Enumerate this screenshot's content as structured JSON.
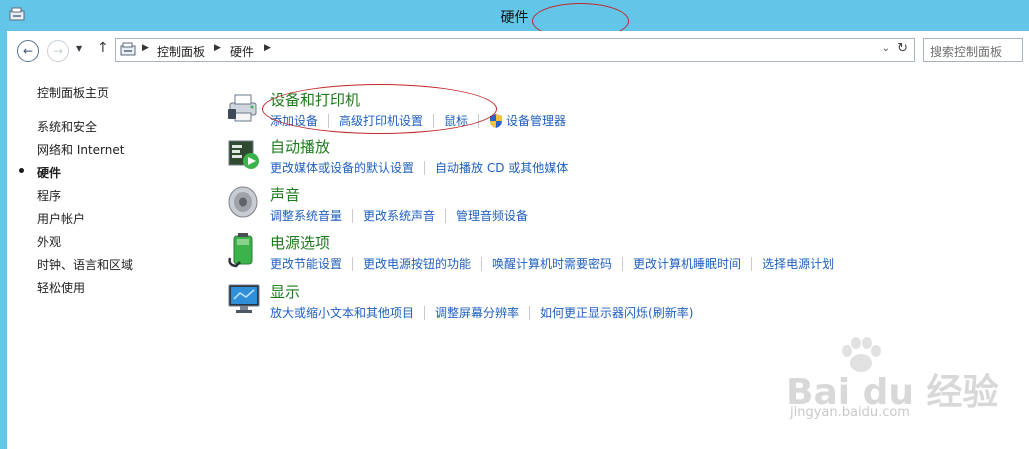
{
  "window": {
    "title": "硬件"
  },
  "address": {
    "crumbs": [
      "控制面板",
      "硬件"
    ],
    "search_placeholder": "搜索控制面板"
  },
  "sidebar": {
    "home": "控制面板主页",
    "items": [
      {
        "label": "系统和安全",
        "current": false
      },
      {
        "label": "网络和 Internet",
        "current": false
      },
      {
        "label": "硬件",
        "current": true
      },
      {
        "label": "程序",
        "current": false
      },
      {
        "label": "用户帐户",
        "current": false
      },
      {
        "label": "外观",
        "current": false
      },
      {
        "label": "时钟、语言和区域",
        "current": false
      },
      {
        "label": "轻松使用",
        "current": false
      }
    ]
  },
  "categories": [
    {
      "title": "设备和打印机",
      "icon": "printer-icon",
      "links": [
        "添加设备",
        "高级打印机设置",
        "鼠标",
        "设备管理器"
      ]
    },
    {
      "title": "自动播放",
      "icon": "autoplay-icon",
      "links": [
        "更改媒体或设备的默认设置",
        "自动播放 CD 或其他媒体"
      ]
    },
    {
      "title": "声音",
      "icon": "speaker-icon",
      "links": [
        "调整系统音量",
        "更改系统声音",
        "管理音频设备"
      ]
    },
    {
      "title": "电源选项",
      "icon": "battery-icon",
      "links": [
        "更改节能设置",
        "更改电源按钮的功能",
        "唤醒计算机时需要密码",
        "更改计算机睡眠时间",
        "选择电源计划"
      ]
    },
    {
      "title": "显示",
      "icon": "monitor-icon",
      "links": [
        "放大或缩小文本和其他项目",
        "调整屏幕分辨率",
        "如何更正显示器闪烁(刷新率)"
      ]
    }
  ],
  "watermark": {
    "text": "Bai du 经验",
    "sub": "jingyan.baidu.com"
  },
  "colors": {
    "titlebar": "#63c6e8",
    "link": "#1f5fbf",
    "category_title": "#1e7a1e",
    "annotation": "#c0282a"
  }
}
